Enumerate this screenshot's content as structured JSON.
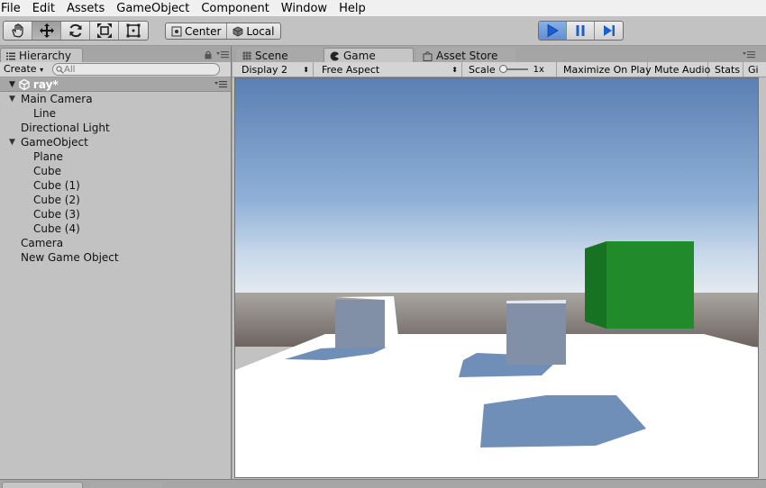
{
  "menu": [
    "File",
    "Edit",
    "Assets",
    "GameObject",
    "Component",
    "Window",
    "Help"
  ],
  "toolbar": {
    "tools": [
      "hand-tool",
      "move-tool",
      "rotate-tool",
      "scale-tool",
      "rect-tool"
    ],
    "active_tool": "move-tool",
    "pivot_label": "Center",
    "space_label": "Local",
    "play_state": "playing"
  },
  "hierarchy": {
    "tab_label": "Hierarchy",
    "create_label": "Create",
    "search_placeholder": "All",
    "scene_name": "ray*",
    "items": [
      {
        "label": "Main Camera",
        "depth": 0,
        "expanded": true
      },
      {
        "label": "Line",
        "depth": 1
      },
      {
        "label": "Directional Light",
        "depth": 0
      },
      {
        "label": "GameObject",
        "depth": 0,
        "expanded": true
      },
      {
        "label": "Plane",
        "depth": 1
      },
      {
        "label": "Cube",
        "depth": 1
      },
      {
        "label": "Cube (1)",
        "depth": 1
      },
      {
        "label": "Cube (2)",
        "depth": 1
      },
      {
        "label": "Cube (3)",
        "depth": 1
      },
      {
        "label": "Cube (4)",
        "depth": 1
      },
      {
        "label": "Camera",
        "depth": 0
      },
      {
        "label": "New Game Object",
        "depth": 0
      }
    ]
  },
  "game": {
    "tabs": [
      "Scene",
      "Game",
      "Asset Store"
    ],
    "active_tab": "Game",
    "display": "Display 2",
    "aspect": "Free Aspect",
    "scale_label": "Scale",
    "scale_value": "1x",
    "maximize_label": "Maximize On Play",
    "mute_label": "Mute Audio",
    "stats_label": "Stats",
    "gizmos_label": "Gi"
  },
  "colors": {
    "accent_play": "#3f7fd6",
    "cube_green": "#218a2a",
    "cube_grey": "#8190a6",
    "sky_top": "#5b7fb2",
    "shadow": "#6f8fb8"
  }
}
